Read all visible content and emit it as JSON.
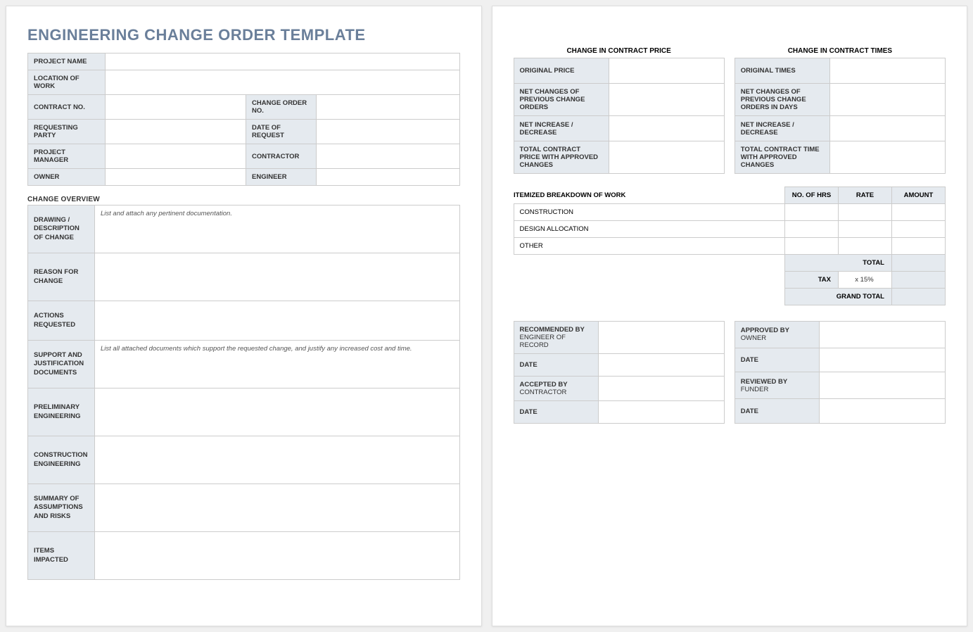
{
  "title": "ENGINEERING CHANGE ORDER TEMPLATE",
  "header": {
    "projectName": "PROJECT NAME",
    "locationOfWork": "LOCATION OF WORK",
    "contractNo": "CONTRACT NO.",
    "changeOrderNo": "CHANGE ORDER NO.",
    "requestingParty": "REQUESTING PARTY",
    "dateOfRequest": "DATE OF REQUEST",
    "projectManager": "PROJECT MANAGER",
    "contractor": "CONTRACTOR",
    "owner": "OWNER",
    "engineer": "ENGINEER"
  },
  "overviewTitle": "CHANGE OVERVIEW",
  "overview": {
    "drawing": {
      "label": "DRAWING / DESCRIPTION OF CHANGE",
      "hint": "List and attach any pertinent documentation."
    },
    "reason": {
      "label": "REASON FOR CHANGE"
    },
    "actions": {
      "label": "ACTIONS REQUESTED"
    },
    "support": {
      "label": "SUPPORT AND JUSTIFICATION DOCUMENTS",
      "hint": "List all attached documents which support the requested change, and justify any increased cost and time."
    },
    "prelim": {
      "label": "PRELIMINARY ENGINEERING"
    },
    "construction": {
      "label": "CONSTRUCTION ENGINEERING"
    },
    "summary": {
      "label": "SUMMARY OF ASSUMPTIONS AND RISKS"
    },
    "items": {
      "label": "ITEMS IMPACTED"
    }
  },
  "price": {
    "title": "CHANGE IN CONTRACT PRICE",
    "originalPrice": "ORIGINAL PRICE",
    "netChanges": "NET CHANGES OF PREVIOUS CHANGE ORDERS",
    "netIncrease": "NET INCREASE / DECREASE",
    "total": "TOTAL CONTRACT PRICE WITH APPROVED CHANGES"
  },
  "times": {
    "title": "CHANGE IN CONTRACT TIMES",
    "originalTimes": "ORIGINAL TIMES",
    "netChanges": "NET CHANGES OF PREVIOUS CHANGE ORDERS IN DAYS",
    "netIncrease": "NET INCREASE / DECREASE",
    "total": "TOTAL CONTRACT TIME WITH APPROVED CHANGES"
  },
  "breakdown": {
    "title": "ITEMIZED BREAKDOWN OF WORK",
    "hrs": "NO. OF HRS",
    "rate": "RATE",
    "amount": "AMOUNT",
    "rows": {
      "construction": "CONSTRUCTION",
      "design": "DESIGN ALLOCATION",
      "other": "OTHER"
    },
    "total": "TOTAL",
    "tax": "TAX",
    "taxRate": "x 15%",
    "grand": "GRAND TOTAL"
  },
  "sig": {
    "recommended": "RECOMMENDED BY",
    "recommendedSub": "ENGINEER OF RECORD",
    "approved": "APPROVED BY",
    "approvedSub": "OWNER",
    "accepted": "ACCEPTED BY",
    "acceptedSub": "CONTRACTOR",
    "reviewed": "REVIEWED BY",
    "reviewedSub": "FUNDER",
    "date": "DATE"
  }
}
